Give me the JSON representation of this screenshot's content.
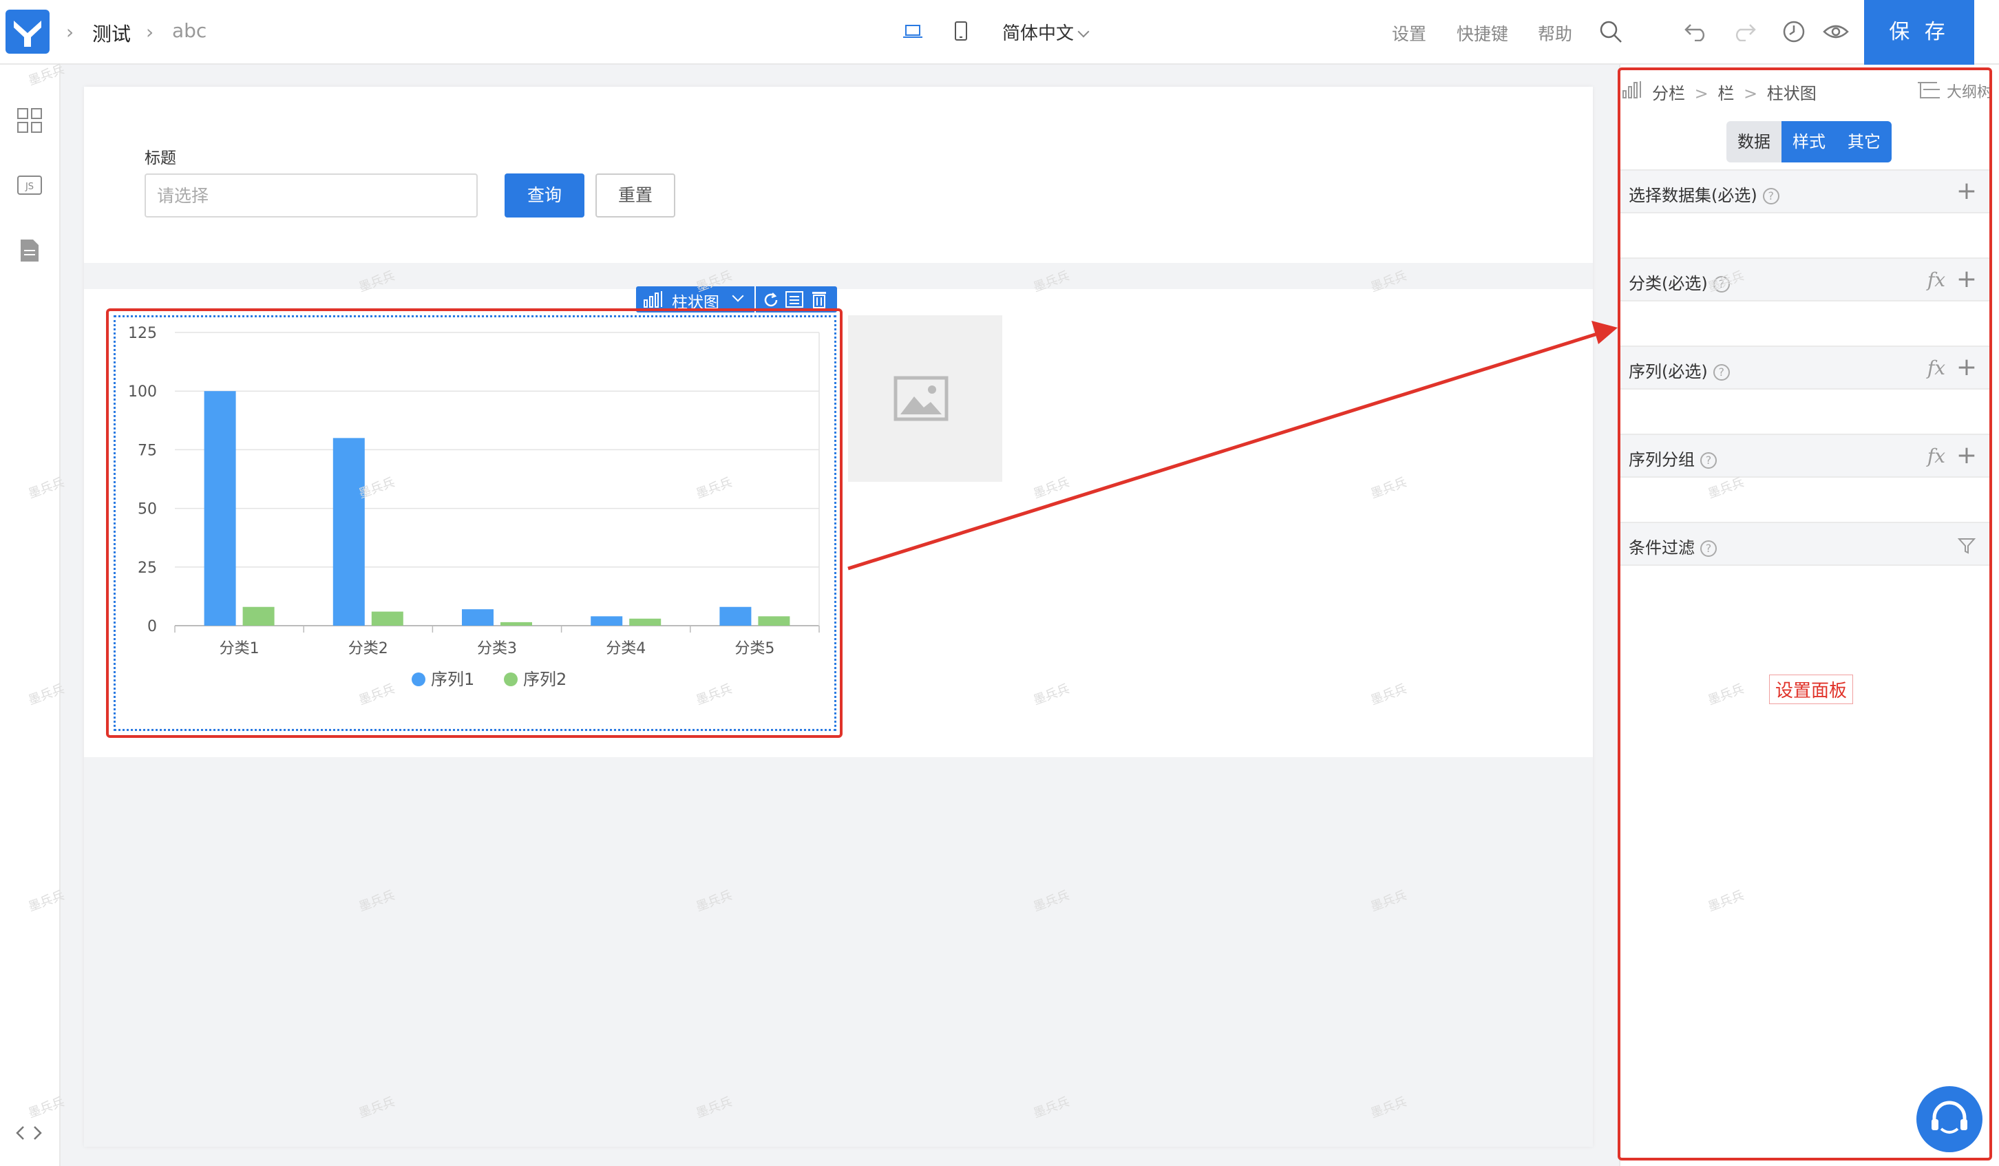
{
  "topbar": {
    "breadcrumb": [
      "测试",
      "abc"
    ],
    "language": "简体中文",
    "links": [
      "设置",
      "快捷键",
      "帮助"
    ],
    "save_label": "保 存",
    "icons": [
      "desktop-icon",
      "mobile-icon",
      "search-icon",
      "undo-icon",
      "redo-icon",
      "history-icon",
      "preview-icon"
    ]
  },
  "leftbar": {
    "icons": [
      "components-grid-icon",
      "js-icon",
      "file-icon",
      "code-toggle-icon"
    ],
    "js_label": "JS"
  },
  "form": {
    "label": "标题",
    "placeholder": "请选择",
    "query_label": "查询",
    "reset_label": "重置"
  },
  "chart_toolbar": {
    "type_label": "柱状图"
  },
  "chart_data": {
    "type": "bar",
    "categories": [
      "分类1",
      "分类2",
      "分类3",
      "分类4",
      "分类5"
    ],
    "series": [
      {
        "name": "序列1",
        "values": [
          100,
          80,
          7,
          4,
          8
        ],
        "color": "#4a9ff5"
      },
      {
        "name": "序列2",
        "values": [
          8,
          6,
          1.5,
          3,
          4
        ],
        "color": "#8fcf7a"
      }
    ],
    "yticks": [
      "0",
      "25",
      "50",
      "75",
      "100",
      "125"
    ],
    "ylim": [
      0,
      125
    ],
    "grid": true,
    "legend": "bottom-center"
  },
  "right_panel": {
    "breadcrumb": [
      "分栏",
      ">",
      "栏",
      ">",
      "柱状图"
    ],
    "outline_label": "大纲树",
    "tabs": [
      "数据",
      "样式",
      "其它"
    ],
    "sections": [
      {
        "label": "选择数据集(必选)",
        "fx": false,
        "plus": true
      },
      {
        "label": "分类(必选)",
        "fx": true,
        "plus": true
      },
      {
        "label": "序列(必选)",
        "fx": true,
        "plus": true
      },
      {
        "label": "序列分组",
        "fx": true,
        "plus": true
      },
      {
        "label": "条件过滤",
        "fx": false,
        "plus": false,
        "filter": true
      }
    ],
    "help_glyph": "?",
    "fx_glyph": "fx",
    "plus_glyph": "+",
    "annotation_label": "设置面板"
  },
  "watermark": "墨兵兵",
  "colors": {
    "accent": "#2a7ae2",
    "annotation": "#e0332a"
  }
}
